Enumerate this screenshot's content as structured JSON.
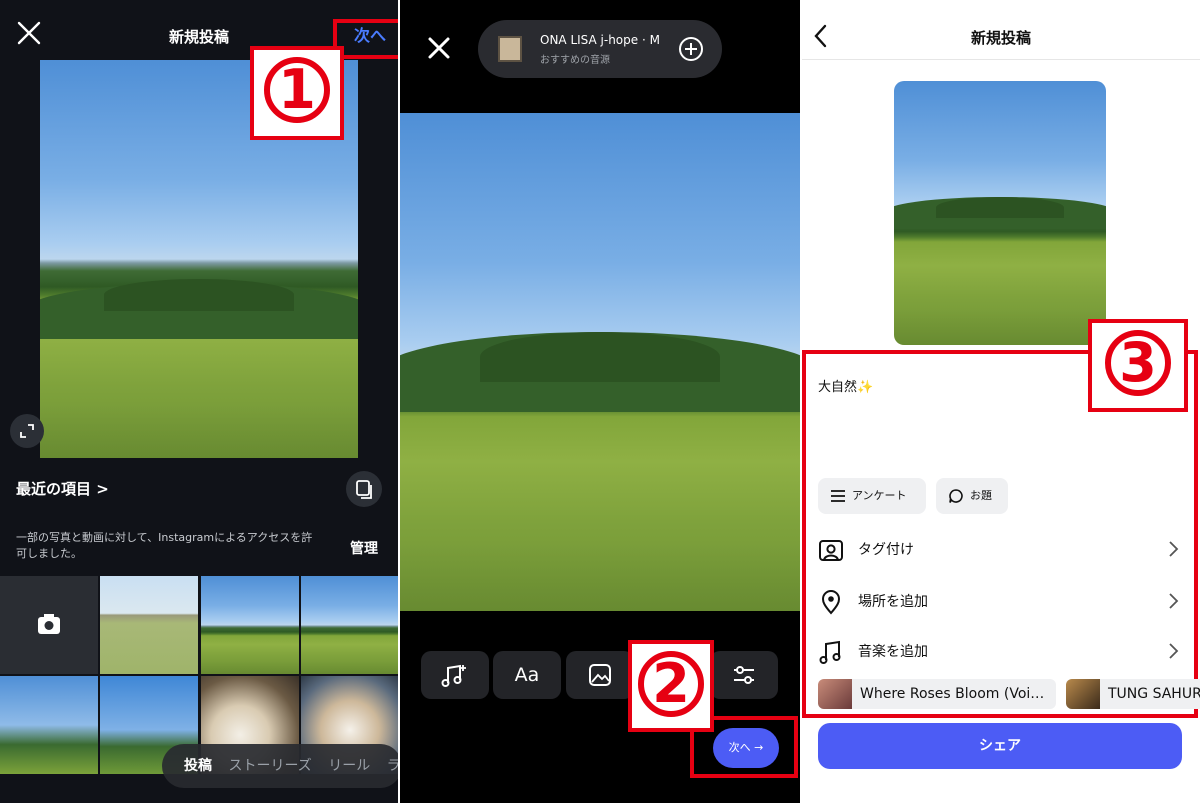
{
  "panel1": {
    "title": "新規投稿",
    "next_label": "次へ",
    "step_number": "1",
    "recent_label": "最近の項目 >",
    "permission_text": "一部の写真と動画に対して、Instagramによるアクセスを許可しました。",
    "manage_label": "管理",
    "mode_tabs": [
      "投稿",
      "ストーリーズ",
      "リール",
      "ラ"
    ]
  },
  "panel2": {
    "music": {
      "title": "ONA LISA  j-hope · M",
      "subtitle": "おすすめの音源"
    },
    "tools": [
      "music-add",
      "Aa",
      "sticker",
      "filter",
      "adjust"
    ],
    "step_number": "2",
    "next_label": "次へ →"
  },
  "panel3": {
    "title": "新規投稿",
    "step_number": "3",
    "caption": "大自然✨",
    "chips": [
      "アンケート",
      "お題"
    ],
    "rows": [
      "タグ付け",
      "場所を追加",
      "音楽を追加"
    ],
    "songs": [
      "Where Roses Bloom (Voi…",
      "TUNG SAHUR"
    ],
    "share_label": "シェア"
  },
  "colors": {
    "accent_blue": "#4c5cf5",
    "annotation_red": "#e60012",
    "link_blue": "#4a7cff"
  }
}
